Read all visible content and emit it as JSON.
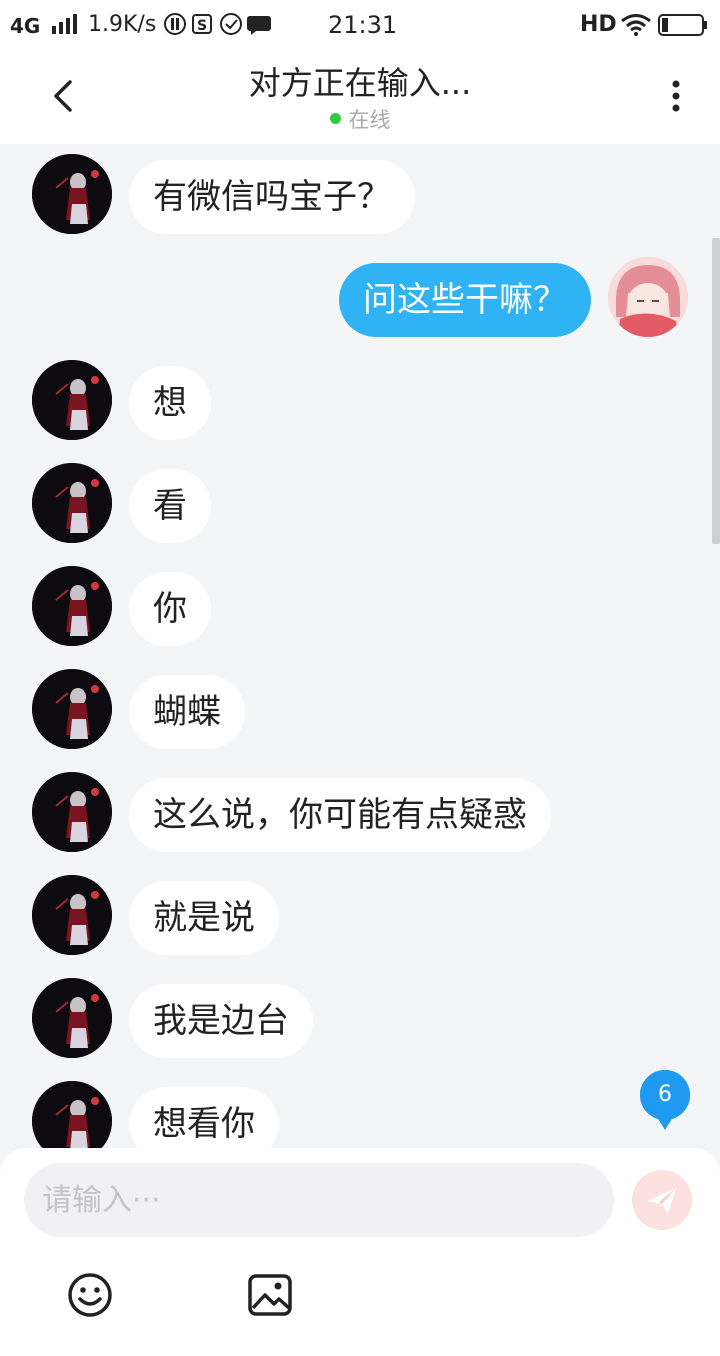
{
  "status_bar": {
    "network": "4G",
    "speed": "1.9K/s",
    "time": "21:31",
    "hd": "HD",
    "icons": [
      "signal-icon",
      "data-saver-icon",
      "s-app-icon",
      "shield-icon",
      "chat-bubble-icon",
      "wifi-icon",
      "battery-icon"
    ]
  },
  "header": {
    "back_icon": "chevron-left-icon",
    "title": "对方正在输入...",
    "status": "在线",
    "status_color": "#2ecc40",
    "more_icon": "more-vertical-icon"
  },
  "messages": [
    {
      "side": "left",
      "text": "有微信吗宝子？"
    },
    {
      "side": "right",
      "text": "问这些干嘛？"
    },
    {
      "side": "left",
      "text": "想"
    },
    {
      "side": "left",
      "text": "看"
    },
    {
      "side": "left",
      "text": "你"
    },
    {
      "side": "left",
      "text": "蝴蝶"
    },
    {
      "side": "left",
      "text": "这么说，你可能有点疑惑"
    },
    {
      "side": "left",
      "text": "就是说"
    },
    {
      "side": "left",
      "text": "我是边台"
    },
    {
      "side": "left",
      "text": "想看你"
    }
  ],
  "unread": {
    "count": "6",
    "color": "#1e9af0"
  },
  "composer": {
    "placeholder": "请输入···",
    "send_icon": "paper-plane-icon",
    "emoji_icon": "smiley-icon",
    "image_icon": "image-icon"
  },
  "colors": {
    "outgoing_bubble": "#2fb3f5",
    "incoming_bubble": "#ffffff",
    "background": "#f4f5f7",
    "send_button": "#fde0e0"
  }
}
